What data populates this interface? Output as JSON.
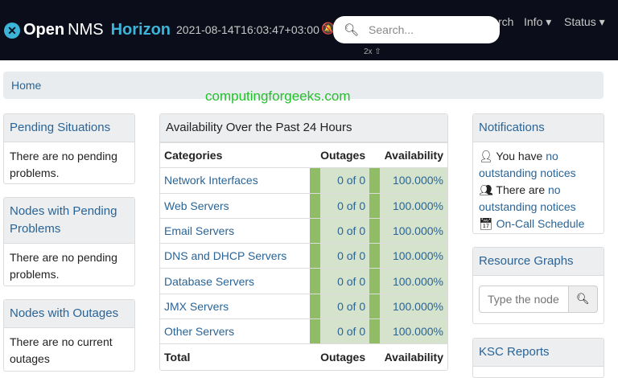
{
  "nav": {
    "logo_open": "Open",
    "logo_nms": "NMS",
    "logo_horizon": "Horizon",
    "timestamp": "2021-08-14T16:03:47+03:00",
    "search_placeholder": "Search...",
    "search_partial": "rch",
    "info": "Info ▾",
    "status": "Status ▾",
    "kbd_hint": "2x ⇧"
  },
  "breadcrumb": "Home",
  "watermark": "computingforgeeks.com",
  "left": [
    {
      "title": "Pending Situations",
      "body": "There are no pending problems."
    },
    {
      "title": "Nodes with Pending Problems",
      "body": "There are no pending problems."
    },
    {
      "title": "Nodes with Outages",
      "body": "There are no current outages"
    }
  ],
  "availability": {
    "title": "Availability Over the Past 24 Hours",
    "headers": [
      "Categories",
      "Outages",
      "Availability"
    ],
    "rows": [
      {
        "name": "Network Interfaces",
        "outages": "0 of 0",
        "avail": "100.000%"
      },
      {
        "name": "Web Servers",
        "outages": "0 of 0",
        "avail": "100.000%"
      },
      {
        "name": "Email Servers",
        "outages": "0 of 0",
        "avail": "100.000%"
      },
      {
        "name": "DNS and DHCP Servers",
        "outages": "0 of 0",
        "avail": "100.000%"
      },
      {
        "name": "Database Servers",
        "outages": "0 of 0",
        "avail": "100.000%"
      },
      {
        "name": "JMX Servers",
        "outages": "0 of 0",
        "avail": "100.000%"
      },
      {
        "name": "Other Servers",
        "outages": "0 of 0",
        "avail": "100.000%"
      }
    ],
    "total": [
      "Total",
      "Outages",
      "Availability"
    ]
  },
  "notifications": {
    "title": "Notifications",
    "you_have": "You have",
    "no_notices": "no outstanding notices",
    "there_are": "There are",
    "no_notices2": "no outstanding notices",
    "oncall": "On-Call Schedule"
  },
  "resource_graphs": {
    "title": "Resource Graphs",
    "placeholder": "Type the node"
  },
  "ksc": {
    "title": "KSC Reports"
  }
}
